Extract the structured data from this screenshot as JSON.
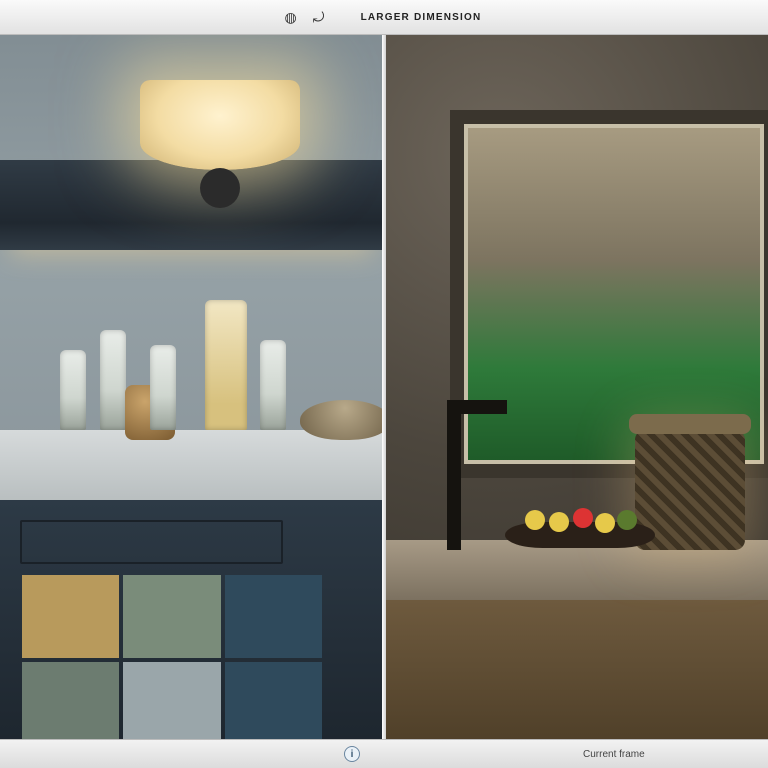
{
  "toolbar": {
    "title_right": "LARGER DIMENSION",
    "tool_pin": "◍",
    "tool_reset": "⤾"
  },
  "status": {
    "info_glyph": "i",
    "caption_right": "Current frame"
  }
}
